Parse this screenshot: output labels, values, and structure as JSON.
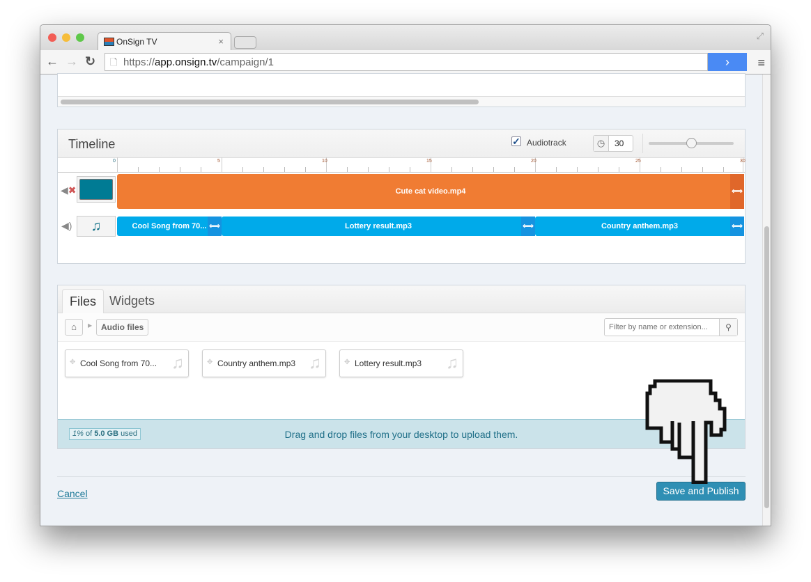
{
  "browser": {
    "tab_title": "OnSign TV",
    "url_scheme": "https://",
    "url_host": "app.onsign.tv",
    "url_path": "/campaign/1"
  },
  "timeline": {
    "title": "Timeline",
    "audiotrack_label": "Audiotrack",
    "audiotrack_checked": true,
    "duration": "30",
    "zoom_level": 0.5,
    "ruler_labels": [
      "0",
      "5",
      "10",
      "15",
      "20",
      "25",
      "30"
    ],
    "video_clips": [
      {
        "name": "Cute cat video.mp4",
        "start": 0,
        "end": 30,
        "color": "#f07c33"
      }
    ],
    "audio_clips": [
      {
        "name": "Cool Song from 70...",
        "start": 0,
        "end": 5
      },
      {
        "name": "Lottery result.mp3",
        "start": 5,
        "end": 20
      },
      {
        "name": "Country anthem.mp3",
        "start": 20,
        "end": 30
      }
    ],
    "audio_color": "#00aaea"
  },
  "files": {
    "tabs": [
      "Files",
      "Widgets"
    ],
    "active_tab": "Files",
    "breadcrumb": "Audio files",
    "filter_placeholder": "Filter by name or extension...",
    "items": [
      "Cool Song from 70...",
      "Country anthem.mp3",
      "Lottery result.mp3"
    ],
    "usage_pct": "1%",
    "usage_of": " of ",
    "usage_total": "5.0 GB",
    "usage_used": " used",
    "drop_text": "Drag and drop files from your desktop to upload them."
  },
  "footer": {
    "cancel": "Cancel",
    "save": "Save and Publish"
  }
}
